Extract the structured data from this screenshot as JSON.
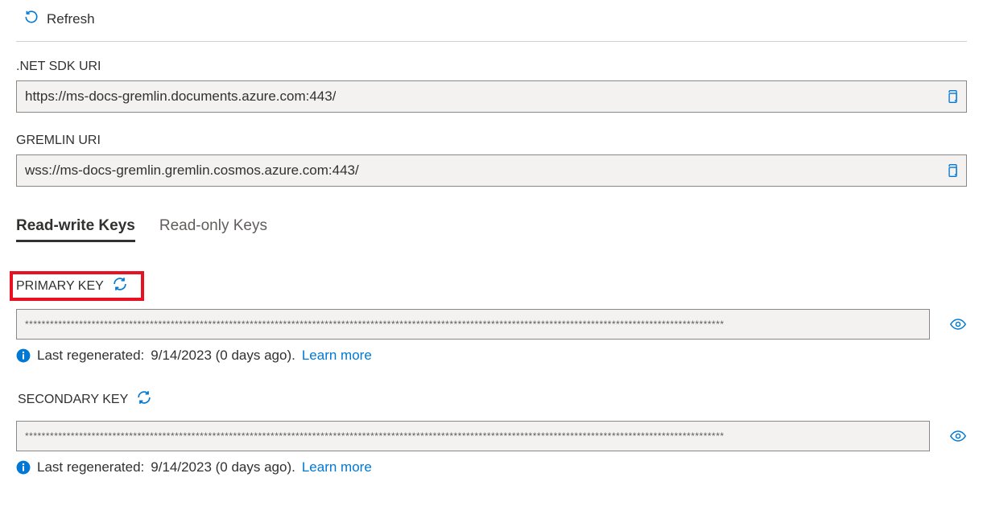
{
  "toolbar": {
    "refresh": "Refresh"
  },
  "fields": {
    "net_sdk_uri_label": ".NET SDK URI",
    "net_sdk_uri_value": "https://ms-docs-gremlin.documents.azure.com:443/",
    "gremlin_uri_label": "GREMLIN URI",
    "gremlin_uri_value": "wss://ms-docs-gremlin.gremlin.cosmos.azure.com:443/"
  },
  "tabs": {
    "read_write": "Read-write Keys",
    "read_only": "Read-only Keys"
  },
  "keys": {
    "primary_label": "PRIMARY KEY",
    "secondary_label": "SECONDARY KEY",
    "masked": "************************************************************************************************************************************************************************"
  },
  "info": {
    "regen_prefix": "Last regenerated: ",
    "regen_date": "9/14/2023 (0 days ago).",
    "learn_more": "Learn more"
  }
}
